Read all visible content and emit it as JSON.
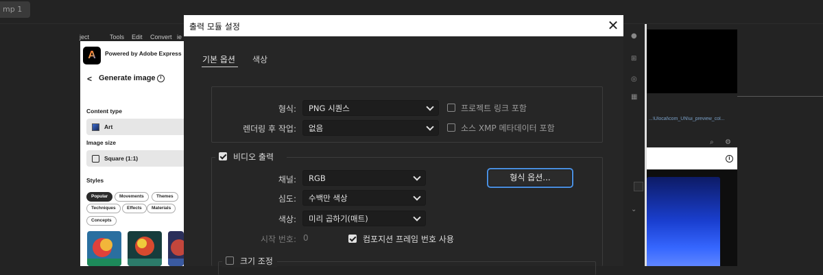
{
  "app": {
    "tab_label": "mp 1",
    "menu_fragments": [
      "ject",
      "Tools",
      "Edit",
      "Convert",
      "ie"
    ]
  },
  "express_panel": {
    "brand": "Powered by Adobe Express",
    "logo_glyph": "A",
    "back_glyph": "<",
    "title": "Generate image",
    "info_glyph": "i",
    "content_type_label": "Content type",
    "content_type_value": "Art",
    "image_size_label": "Image size",
    "image_size_value": "Square (1:1)",
    "styles_label": "Styles",
    "style_chips": [
      "Popular",
      "Movements",
      "Themes",
      "Techniques",
      "Effects",
      "Materials",
      "Concepts"
    ],
    "active_chip": "Popular"
  },
  "right_panel": {
    "caption": "...\\Ulocal\\com_UN\\ui_preview_col...",
    "info_glyph": "i"
  },
  "modal": {
    "title": "출력 모듈 설정",
    "close_glyph": "✕",
    "tabs": [
      {
        "label": "기본 옵션",
        "active": true
      },
      {
        "label": "색상",
        "active": false
      }
    ],
    "format": {
      "label": "형식:",
      "value": "PNG 시퀀스",
      "checkbox_label": "프로젝트 링크 포함",
      "checked": false
    },
    "post_render": {
      "label": "렌더링 후 작업:",
      "value": "없음",
      "checkbox_label": "소스 XMP 메타데이터 포함",
      "checked": false
    },
    "video_output": {
      "label": "비디오 출력",
      "checked": true,
      "channels": {
        "label": "채널:",
        "value": "RGB"
      },
      "depth": {
        "label": "심도:",
        "value": "수백만 색상"
      },
      "color": {
        "label": "색상:",
        "value": "미리 곱하기(매트)"
      },
      "start_number": {
        "label": "시작 번호:",
        "value": "0"
      },
      "use_comp_frame": {
        "label": "컴포지션 프레임 번호 사용",
        "checked": true
      },
      "format_options_button": "형식 옵션..."
    },
    "resize": {
      "label": "크기 조정",
      "checked": false
    }
  }
}
